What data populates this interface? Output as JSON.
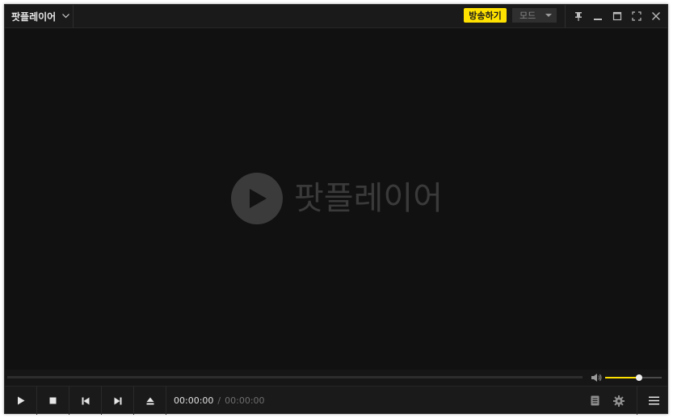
{
  "app": {
    "menu_label": "팟플레이어",
    "logo_text": "팟플레이어"
  },
  "titlebar": {
    "broadcast_label": "방송하기",
    "mode_label": "모드",
    "buttons": [
      "pin-icon",
      "minimize-icon",
      "maximize-icon",
      "fullscreen-icon",
      "close-icon"
    ]
  },
  "playback": {
    "current_time": "00:00:00",
    "separator": "/",
    "total_time": "00:00:00",
    "progress": 0,
    "volume": 0.6
  },
  "colors": {
    "accent": "#ffe100",
    "background": "#121212"
  }
}
